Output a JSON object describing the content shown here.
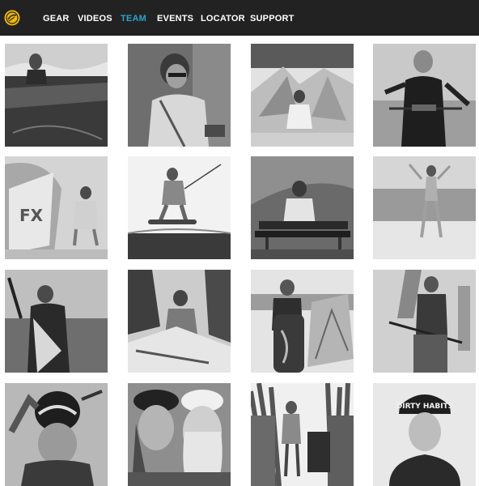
{
  "nav": {
    "logo": "cabrinha-logo",
    "items": [
      {
        "id": "gear",
        "label": "GEAR",
        "active": false
      },
      {
        "id": "videos",
        "label": "VIDEOS",
        "active": false
      },
      {
        "id": "team",
        "label": "TEAM",
        "active": true
      },
      {
        "id": "events",
        "label": "EVENTS",
        "active": false
      },
      {
        "id": "locator",
        "label": "LOCATOR",
        "active": false
      },
      {
        "id": "support",
        "label": "SUPPORT",
        "active": false
      }
    ],
    "colors": {
      "background": "#222222",
      "text": "#ffffff",
      "active": "#2aa5cf",
      "logo": "#f2b705"
    }
  },
  "team_grid": {
    "columns": 4,
    "rows": 4,
    "photos": [
      {
        "scene": "rider-over-water"
      },
      {
        "scene": "rider-sunglasses-portrait"
      },
      {
        "scene": "rider-seated-under-kites"
      },
      {
        "scene": "rider-wetsuit-with-bar"
      },
      {
        "scene": "rider-with-kite-fx"
      },
      {
        "scene": "rider-jumping-board"
      },
      {
        "scene": "rider-sitting-on-boards"
      },
      {
        "scene": "rider-leaping-beach"
      },
      {
        "scene": "rider-wetsuit-holding-kite"
      },
      {
        "scene": "rider-under-palms-kite"
      },
      {
        "scene": "rider-with-board-and-kite"
      },
      {
        "scene": "rider-holding-bar-beach"
      },
      {
        "scene": "rider-helmet-portrait"
      },
      {
        "scene": "two-riders-caps-selfie"
      },
      {
        "scene": "rider-in-tall-grass"
      },
      {
        "scene": "rider-snapback-portrait"
      }
    ],
    "caps_text": {
      "tile16": "DIRTY HABITS"
    }
  }
}
